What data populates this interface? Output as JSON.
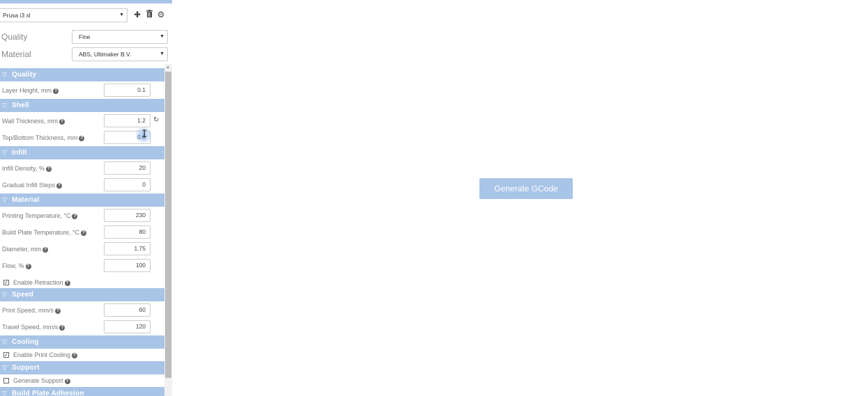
{
  "printer": {
    "selected": "Prusa i3 xl",
    "actions": [
      "plus-icon",
      "trash-icon",
      "gear-icon"
    ]
  },
  "quality_select": {
    "label": "Quality",
    "value": "Fine"
  },
  "material_select": {
    "label": "Material",
    "value": "ABS, Ultimaker B.V."
  },
  "sections": {
    "quality": {
      "title": "Quality",
      "fields": {
        "layer_height": {
          "label": "Layer Height, mm",
          "value": "0.1"
        }
      }
    },
    "shell": {
      "title": "Shell",
      "fields": {
        "wall_thickness": {
          "label": "Wall Thickness, mm",
          "value": "1.2"
        },
        "top_bottom_thickness": {
          "label": "Top/Bottom Thickness, mm",
          "value": "0.8"
        }
      }
    },
    "infill": {
      "title": "Infill",
      "fields": {
        "infill_density": {
          "label": "Infill Density, %",
          "value": "20"
        },
        "gradual_infill_steps": {
          "label": "Gradual Infill Steps",
          "value": "0"
        }
      }
    },
    "material": {
      "title": "Material",
      "fields": {
        "printing_temperature": {
          "label": "Printing Temperature, °C",
          "value": "230"
        },
        "build_plate_temperature": {
          "label": "Build Plate Temperature, °C",
          "value": "80"
        },
        "diameter": {
          "label": "Diameter, mm",
          "value": "1.75"
        },
        "flow": {
          "label": "Flow, %",
          "value": "100"
        }
      },
      "enable_retraction": {
        "label": "Enable Retraction",
        "checked": true
      }
    },
    "speed": {
      "title": "Speed",
      "fields": {
        "print_speed": {
          "label": "Print Speed, mm/s",
          "value": "60"
        },
        "travel_speed": {
          "label": "Travel Speed, mm/s",
          "value": "120"
        }
      }
    },
    "cooling": {
      "title": "Cooling",
      "enable_print_cooling": {
        "label": "Enable Print Cooling",
        "checked": true
      }
    },
    "support": {
      "title": "Support",
      "generate_support": {
        "label": "Generate Support",
        "checked": false
      }
    },
    "build_plate_adhesion": {
      "title": "Build Plate Adhesion"
    }
  },
  "generate_button": {
    "label": "Generate GCode"
  },
  "colors": {
    "accent": "#a8c4e6",
    "accent_text": "#ffffff"
  }
}
